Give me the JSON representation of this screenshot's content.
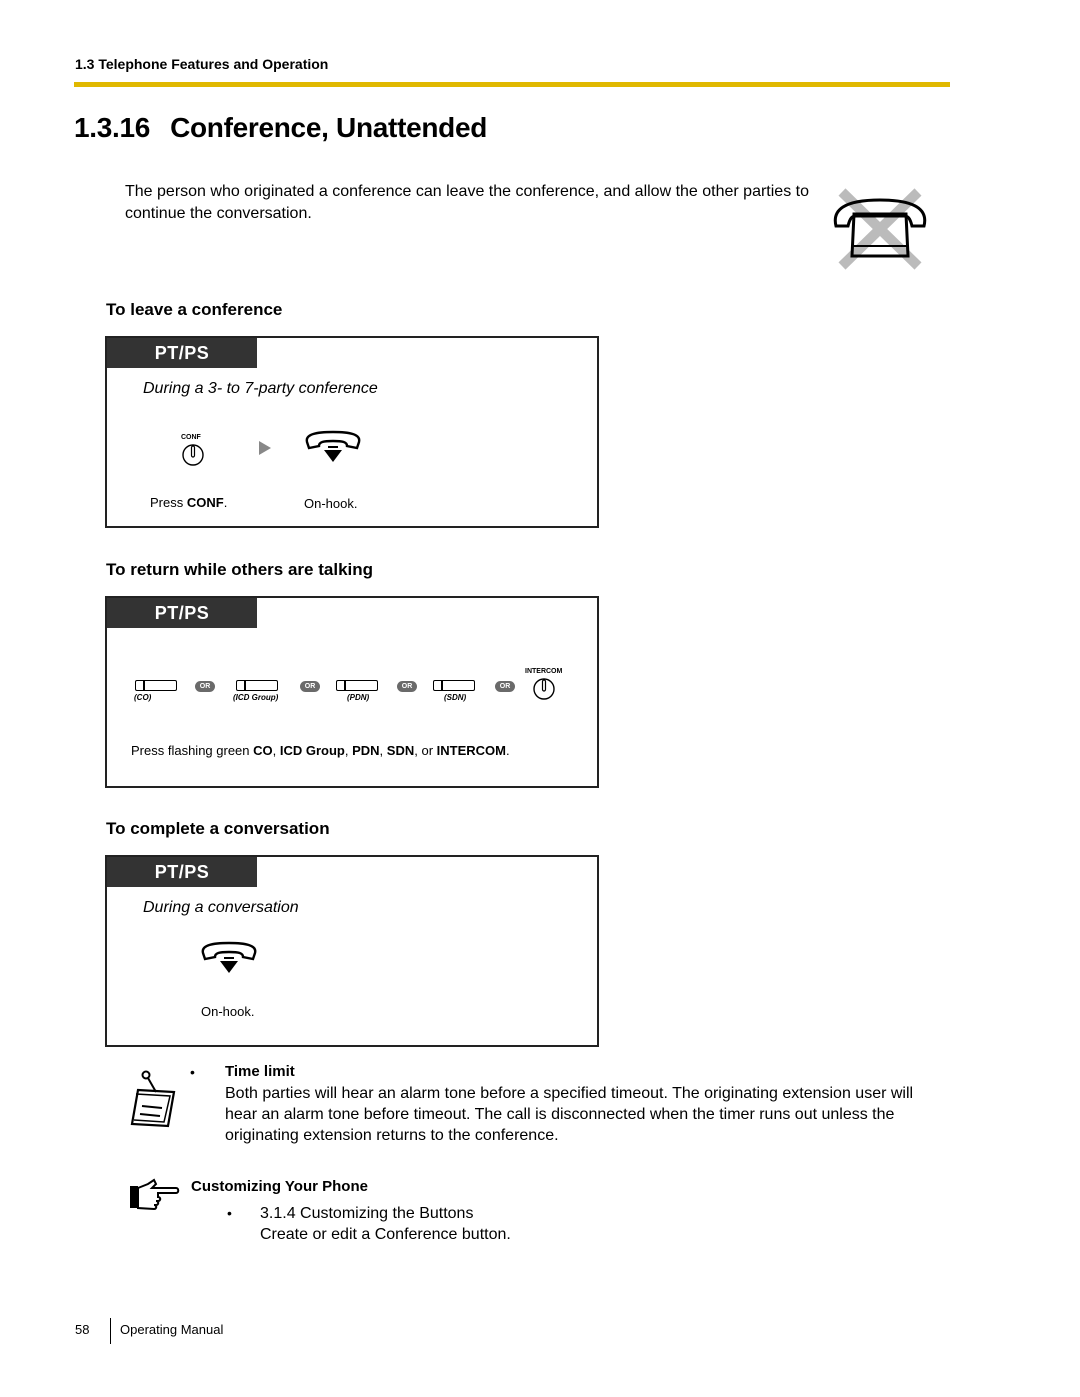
{
  "header": {
    "running_head": "1.3 Telephone Features and Operation",
    "accent_color": "#e0b800"
  },
  "title": {
    "number": "1.3.16",
    "text": "Conference, Unattended"
  },
  "intro": "The person who originated a conference can leave the conference, and allow the other parties to continue the conversation.",
  "hero_icon": "phone-with-x-icon",
  "sections": [
    {
      "heading": "To leave a conference",
      "tab": "PT/PS",
      "condition": "During a 3- to 7-party conference",
      "steps": [
        {
          "icon": "conf-button-icon",
          "icon_label": "CONF",
          "caption_prefix": "Press ",
          "caption_bold": "CONF",
          "caption_suffix": "."
        },
        {
          "icon": "on-hook-icon",
          "caption_prefix": "On-hook.",
          "caption_bold": "",
          "caption_suffix": ""
        }
      ]
    },
    {
      "heading": "To return while others are talking",
      "tab": "PT/PS",
      "buttons": [
        {
          "label": "(CO)"
        },
        {
          "label": "(ICD Group)"
        },
        {
          "label": "(PDN)"
        },
        {
          "label": "(SDN)"
        }
      ],
      "or_label": "OR",
      "intercom_label": "INTERCOM",
      "caption": {
        "p1": "Press flashing green ",
        "b1": "CO",
        "p2": ", ",
        "b2": "ICD Group",
        "p3": ", ",
        "b3": "PDN",
        "p4": ", ",
        "b4": "SDN",
        "p5": ", or ",
        "b5": "INTERCOM",
        "p6": "."
      }
    },
    {
      "heading": "To complete a conversation",
      "tab": "PT/PS",
      "condition": "During a conversation",
      "steps": [
        {
          "icon": "on-hook-icon",
          "caption_prefix": "On-hook."
        }
      ]
    }
  ],
  "note": {
    "icon": "notepad-icon",
    "bullet": "•",
    "title": "Time limit",
    "body": "Both parties will hear an alarm tone before a specified timeout. The originating extension user will hear an alarm tone before timeout. The call is disconnected when the timer runs out unless the originating extension returns to the conference."
  },
  "reference": {
    "icon": "pointing-hand-icon",
    "title": "Customizing Your Phone",
    "bullet": "•",
    "link_text": "3.1.4 Customizing the Buttons",
    "description": "Create or edit a Conference button."
  },
  "footer": {
    "page_number": "58",
    "text": "Operating Manual"
  }
}
